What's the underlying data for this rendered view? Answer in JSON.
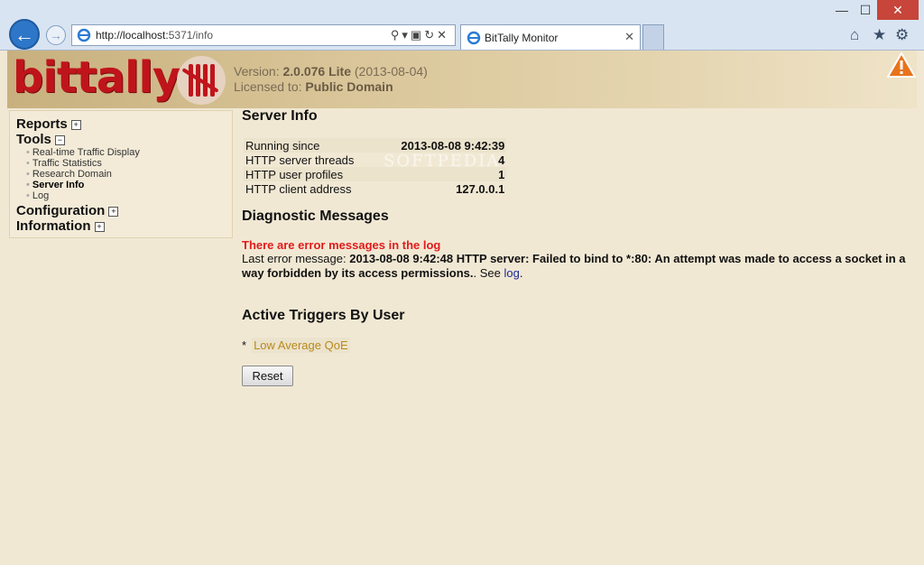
{
  "browser": {
    "window_controls": {
      "minimize": "—",
      "maximize": "☐",
      "close": "✕"
    },
    "url_host": "http://localhost:",
    "url_rest": "5371/info",
    "tab_title": "BitTally Monitor",
    "tab_close": "✕",
    "icons": [
      "back-arrow-icon",
      "forward-arrow-icon",
      "search-icon",
      "refresh-icon",
      "home-icon",
      "star-icon",
      "gear-icon"
    ]
  },
  "header": {
    "logo": "bittally",
    "version_label": "Version: ",
    "version_value": "2.0.076 Lite",
    "version_date": " (2013-08-04)",
    "license_label": "Licensed to: ",
    "license_value": "Public Domain"
  },
  "sidebar": {
    "reports": "Reports",
    "tools": "Tools",
    "tools_items": [
      "Real-time Traffic Display",
      "Traffic Statistics",
      "Research Domain",
      "Server Info",
      "Log"
    ],
    "configuration": "Configuration",
    "information": "Information"
  },
  "server_info": {
    "heading": "Server Info",
    "rows": [
      {
        "label": "Running since",
        "value": "2013-08-08 9:42:39"
      },
      {
        "label": "HTTP server threads",
        "value": "4"
      },
      {
        "label": "HTTP user profiles",
        "value": "1"
      },
      {
        "label": "HTTP client address",
        "value": "127.0.0.1"
      }
    ],
    "watermark": "SOFTPEDIA"
  },
  "diagnostics": {
    "heading": "Diagnostic Messages",
    "error_title": "There are error messages in the log",
    "last_error_label": "Last error message: ",
    "last_error_text": "2013-08-08 9:42:48 HTTP server: Failed to bind to *:80: An attempt was made to access a socket in a way forbidden by its access permissions.",
    "see_text": ". See ",
    "log_link": "log",
    "end": "."
  },
  "triggers": {
    "heading": "Active Triggers By User",
    "bullet": "*",
    "items": [
      "Low Average QoE"
    ],
    "reset": "Reset"
  },
  "colors": {
    "error": "#e21b1b",
    "logo": "#c0141b",
    "trigger_link": "#b88a1a",
    "background": "#f1e8d4"
  }
}
